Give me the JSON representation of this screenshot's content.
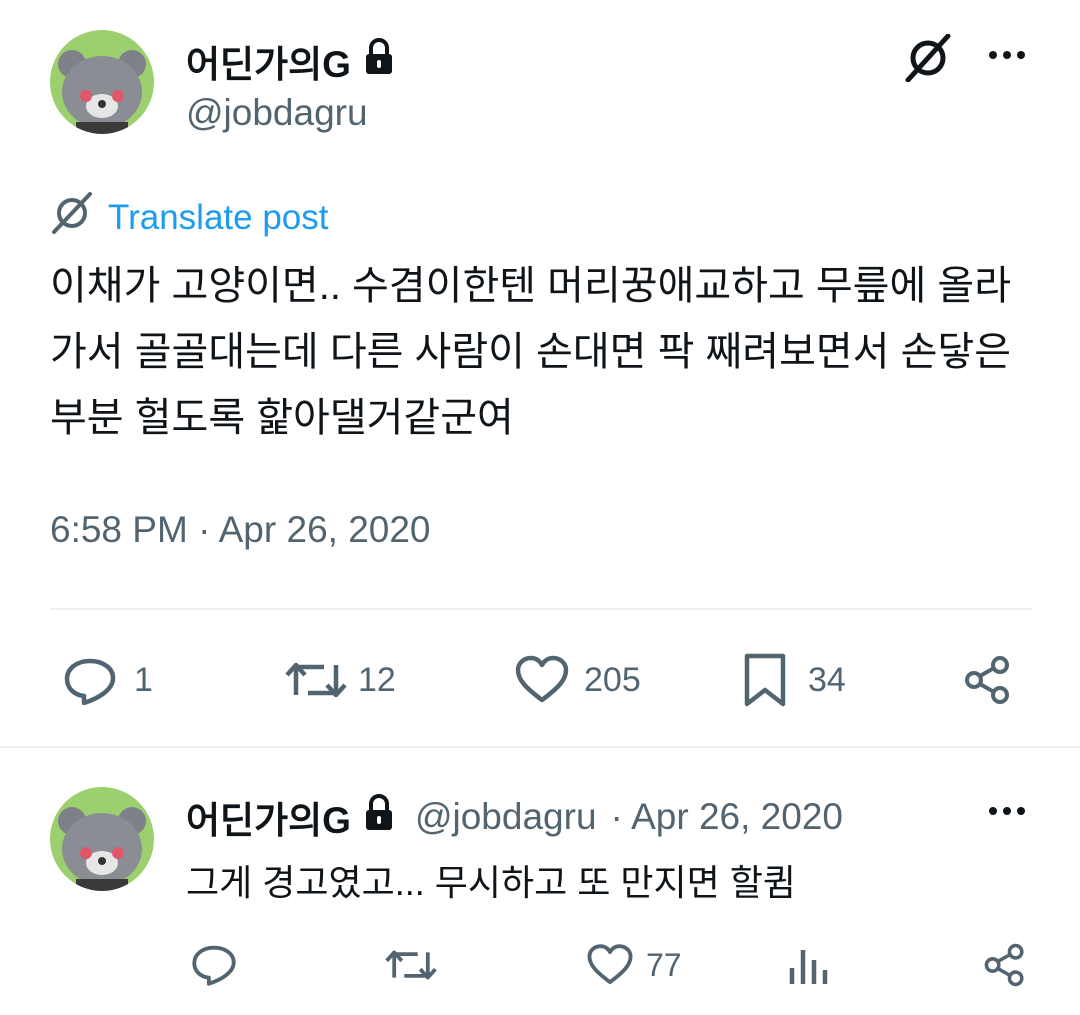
{
  "main_post": {
    "display_name": "어딘가의G",
    "handle": "@jobdagru",
    "translate_label": "Translate post",
    "text": "이채가 고양이면.. 수겸이한텐 머리꿍애교하고 무릎에 올라가서 골골대는데 다른 사람이 손대면 팍 째려보면서 손닿은 부분 헐도록 핥아댈거같군여",
    "timestamp": "6:58 PM · Apr 26, 2020",
    "counts": {
      "replies": "1",
      "reposts": "12",
      "likes": "205",
      "bookmarks": "34"
    }
  },
  "reply_post": {
    "display_name": "어딘가의G",
    "handle": "@jobdagru",
    "date": "· Apr 26, 2020",
    "text": "그게 경고였고... 무시하고 또 만지면 할큄",
    "counts": {
      "likes": "77"
    }
  },
  "icons": {
    "lock": "lock-icon",
    "grok": "grok-icon",
    "more": "more-icon",
    "reply": "reply-icon",
    "repost": "repost-icon",
    "like": "like-icon",
    "bookmark": "bookmark-icon",
    "share": "share-icon",
    "views": "views-icon"
  },
  "colors": {
    "link": "#1d9bf0",
    "secondary": "#536471",
    "text": "#0f1419",
    "divider": "#eff3f4",
    "avatar_bg": "#9ccf6d"
  }
}
